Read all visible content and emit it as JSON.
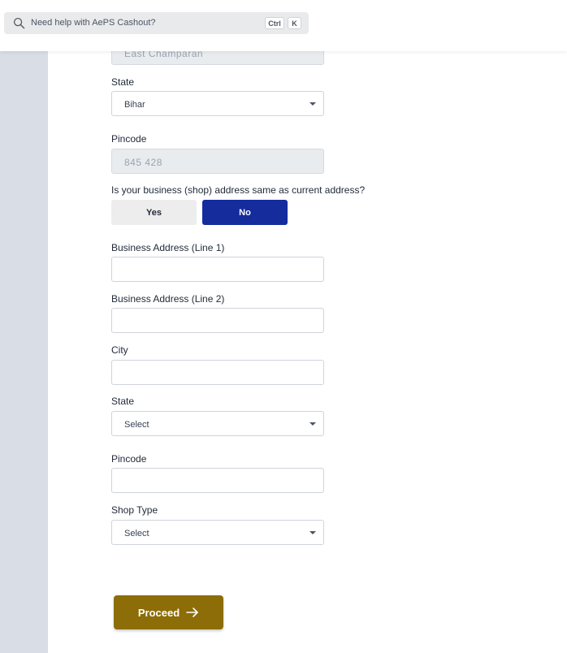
{
  "search": {
    "placeholder": "Need help with AePS Cashout?",
    "shortcut_ctrl": "Ctrl",
    "shortcut_key": "K"
  },
  "current_address": {
    "district_value": "East Champaran",
    "state_label": "State",
    "state_value": "Bihar",
    "pincode_label": "Pincode",
    "pincode_value": "845 428"
  },
  "business_same_question": "Is your business (shop) address same as current address?",
  "toggle": {
    "yes_label": "Yes",
    "no_label": "No",
    "selected": "No"
  },
  "business": {
    "line1_label": "Business Address (Line 1)",
    "line1_value": "",
    "line2_label": "Business Address (Line 2)",
    "line2_value": "",
    "city_label": "City",
    "city_value": "",
    "state_label": "State",
    "state_value": "Select",
    "pincode_label": "Pincode",
    "pincode_value": "",
    "shop_type_label": "Shop Type",
    "shop_type_value": "Select"
  },
  "proceed_label": "Proceed",
  "colors": {
    "primary": "#142c9c",
    "proceed": "#8c6d07",
    "rail": "#d8dde6"
  }
}
